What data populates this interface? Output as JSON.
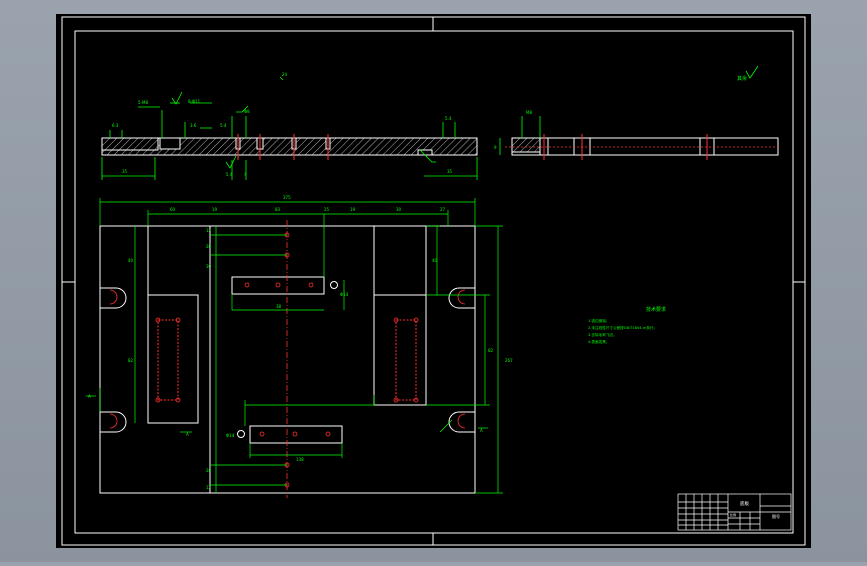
{
  "drawing": {
    "roughness_symbol": "其余",
    "tech_req_title": "技术要求",
    "tech_req_lines": [
      "1.锐边倒钝。",
      "2.未注线性尺寸公差按GB/T1804-m执行。",
      "3.去除毛刺飞边。",
      "4.表面发黑。"
    ],
    "title_block": {
      "part_name": "底板",
      "drawing_no": "图号",
      "scale": "比例"
    }
  },
  "colors": {
    "sheet": "#000000",
    "outline": "#ffffff",
    "dimension": "#00ff00",
    "center_line": "#ff3030",
    "hole": "#ff3030",
    "hatch": "#ffffff",
    "text": "#00ff00"
  }
}
